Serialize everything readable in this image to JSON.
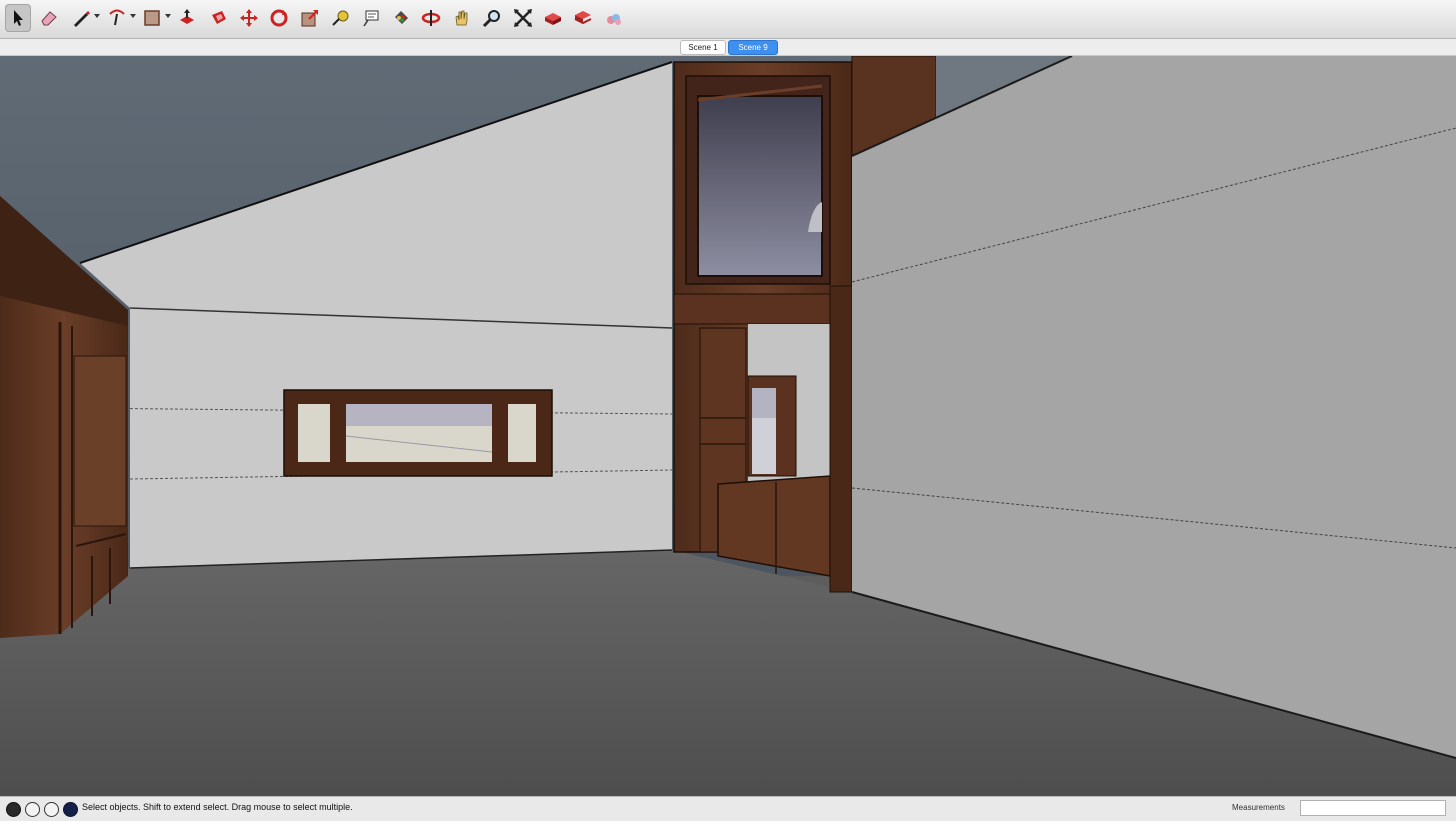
{
  "toolbar": {
    "tools": [
      {
        "name": "select-tool",
        "icon": "arrow-cursor-icon"
      },
      {
        "name": "eraser-tool",
        "icon": "eraser-icon"
      },
      {
        "name": "line-tool",
        "icon": "pencil-icon"
      },
      {
        "name": "arc-tool",
        "icon": "arc-icon"
      },
      {
        "name": "shape-tool",
        "icon": "rectangle-icon"
      },
      {
        "name": "push-pull-tool",
        "icon": "push-pull-icon"
      },
      {
        "name": "offset-tool",
        "icon": "offset-icon"
      },
      {
        "name": "move-tool",
        "icon": "move-arrows-icon"
      },
      {
        "name": "rotate-tool",
        "icon": "rotate-icon"
      },
      {
        "name": "scale-tool",
        "icon": "scale-icon"
      },
      {
        "name": "tape-measure-tool",
        "icon": "tape-measure-icon"
      },
      {
        "name": "text-tool",
        "icon": "text-label-icon"
      },
      {
        "name": "paint-bucket-tool",
        "icon": "paint-bucket-icon"
      },
      {
        "name": "orbit-tool",
        "icon": "orbit-icon"
      },
      {
        "name": "pan-tool",
        "icon": "hand-icon"
      },
      {
        "name": "zoom-tool",
        "icon": "magnifier-icon"
      },
      {
        "name": "zoom-extents-tool",
        "icon": "zoom-extents-icon"
      },
      {
        "name": "warehouse-tool",
        "icon": "warehouse-icon"
      },
      {
        "name": "extension-warehouse-tool",
        "icon": "extension-warehouse-icon"
      },
      {
        "name": "layout-tool",
        "icon": "send-to-layout-icon"
      }
    ],
    "active_tool": "select-tool"
  },
  "scene_tabs": {
    "items": [
      {
        "label": "Scene 1",
        "active": false
      },
      {
        "label": "Scene 9",
        "active": true
      }
    ]
  },
  "status_bar": {
    "message": "Select objects. Shift to extend select. Drag mouse to select multiple.",
    "icons": [
      "geo-location-icon",
      "credits-info-icon",
      "user-account-icon",
      "instructor-icon"
    ],
    "measurements_label": "Measurements",
    "measurements_value": ""
  },
  "colors": {
    "accent": "#3d8ff0",
    "wood": "#5e3622",
    "wood_dark": "#3a1f12",
    "wall": "#c8c8c8",
    "floor": "#5b5b5b",
    "sky": "#56606a"
  }
}
